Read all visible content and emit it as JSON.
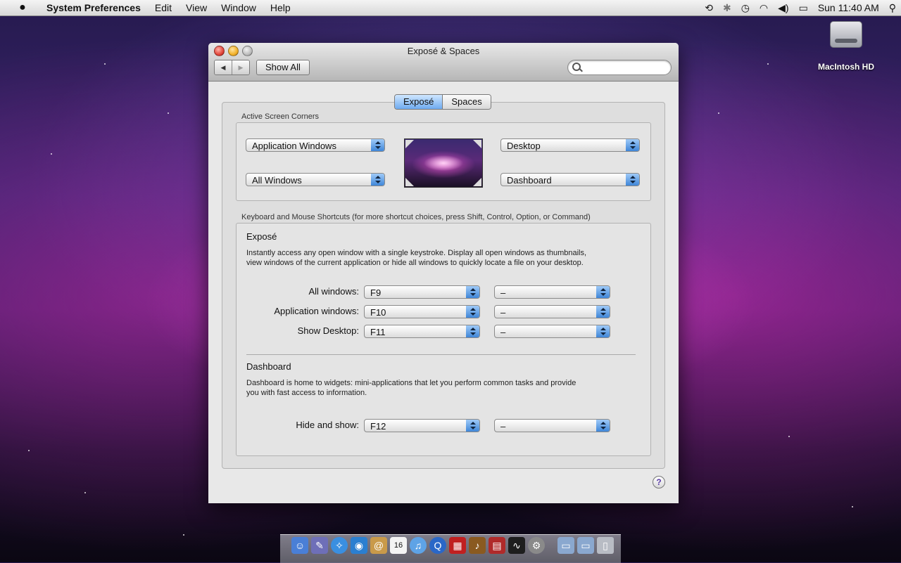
{
  "menubar": {
    "apple": "",
    "app_name": "System Preferences",
    "items": [
      "Edit",
      "View",
      "Window",
      "Help"
    ],
    "clock": "Sun 11:40 AM"
  },
  "desktop": {
    "hd_label": "MacIntosh HD"
  },
  "window": {
    "title": "Exposé & Spaces",
    "show_all_label": "Show All",
    "search_placeholder": "",
    "tabs": [
      {
        "label": "Exposé",
        "active": true
      },
      {
        "label": "Spaces",
        "active": false
      }
    ],
    "corners": {
      "section_label": "Active Screen Corners",
      "top_left": "Application Windows",
      "bottom_left": "All Windows",
      "top_right": "Desktop",
      "bottom_right": "Dashboard"
    },
    "shortcuts": {
      "section_label": "Keyboard and Mouse Shortcuts (for more shortcut choices, press Shift, Control, Option, or Command)",
      "expose": {
        "title": "Exposé",
        "description_line1": "Instantly access any open window with a single keystroke. Display all open windows as thumbnails,",
        "description_line2": "view windows of the current application or hide all windows to quickly locate a file on your desktop.",
        "rows": [
          {
            "label": "All windows:",
            "key": "F9",
            "mouse": "–"
          },
          {
            "label": "Application windows:",
            "key": "F10",
            "mouse": "–"
          },
          {
            "label": "Show Desktop:",
            "key": "F11",
            "mouse": "–"
          }
        ]
      },
      "dashboard": {
        "title": "Dashboard",
        "description_line1": "Dashboard is home to widgets: mini-applications that let you perform common tasks and provide",
        "description_line2": "you with fast access to information.",
        "rows": [
          {
            "label": "Hide and show:",
            "key": "F12",
            "mouse": "–"
          }
        ]
      }
    },
    "help_label": "?"
  },
  "dock": {
    "calendar_day": "16"
  },
  "colors": {
    "accent_blue": "#3f86d8",
    "close": "#e2463b",
    "minimize": "#f2b12a"
  }
}
